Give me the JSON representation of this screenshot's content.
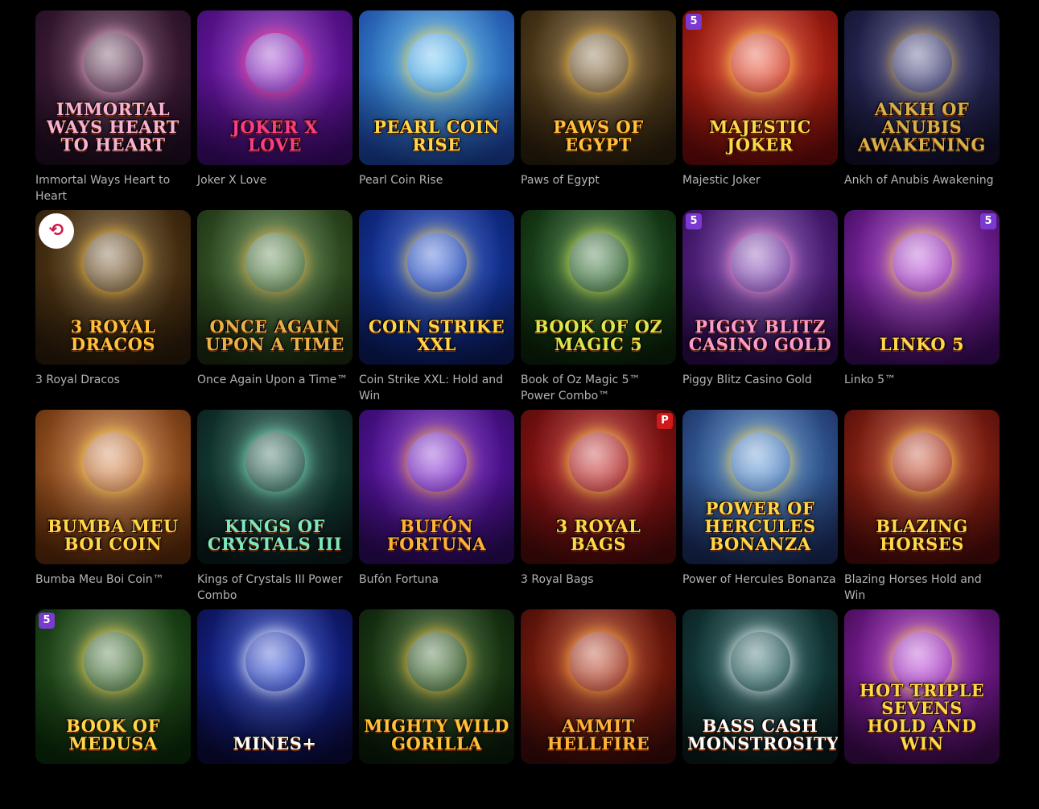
{
  "games": [
    {
      "name": "Immortal Ways Heart to Heart",
      "logo": "Immortal Ways Heart to Heart",
      "bg1": "#5a2a4a",
      "bg2": "#1e0c20",
      "accent": "#f7b2d6",
      "badge": null
    },
    {
      "name": "Joker X Love",
      "logo": "Joker X Love",
      "bg1": "#8a1fc4",
      "bg2": "#3a0a6a",
      "accent": "#ff3b8a",
      "badge": null
    },
    {
      "name": "Pearl Coin Rise",
      "logo": "Pearl Coin Rise",
      "bg1": "#4ab8f0",
      "bg2": "#1a3f9a",
      "accent": "#ffd84a",
      "badge": null
    },
    {
      "name": "Paws of Egypt",
      "logo": "Paws of Egypt",
      "bg1": "#7a5a2a",
      "bg2": "#2a1e0c",
      "accent": "#ffc23a",
      "badge": null
    },
    {
      "name": "Majestic Joker",
      "logo": "Majestic Joker",
      "bg1": "#e83a1a",
      "bg2": "#6a0a0a",
      "accent": "#ffd84a",
      "badge": "5"
    },
    {
      "name": "Ankh of Anubis Awakening",
      "logo": "Ankh of Anubis Awakening",
      "bg1": "#3a3a7a",
      "bg2": "#10102a",
      "accent": "#d7b24a",
      "badge": null
    },
    {
      "name": "3 Royal Dracos",
      "logo": "3 Royal Dracos",
      "bg1": "#6a4a1a",
      "bg2": "#2a1a0a",
      "accent": "#ffc23a",
      "badge": "round"
    },
    {
      "name": "Once Again Upon a Time™",
      "logo": "Once Again Upon a Time",
      "bg1": "#4a7a3a",
      "bg2": "#1a2a10",
      "accent": "#e6b24a",
      "badge": null
    },
    {
      "name": "Coin Strike XXL: Hold and Win",
      "logo": "Coin Strike XXL",
      "bg1": "#1a4ad0",
      "bg2": "#0a1a5a",
      "accent": "#ffd84a",
      "badge": null
    },
    {
      "name": "Book of Oz Magic 5™ Power Combo™",
      "logo": "Book of Oz Magic 5",
      "bg1": "#2a6a2a",
      "bg2": "#0a200a",
      "accent": "#d7e84a",
      "badge": null
    },
    {
      "name": "Piggy Blitz Casino Gold",
      "logo": "Piggy Blitz Casino Gold",
      "bg1": "#7a3ab0",
      "bg2": "#2a0a4a",
      "accent": "#ff9ad0",
      "badge": "5"
    },
    {
      "name": "Linko 5™",
      "logo": "Linko 5",
      "bg1": "#b03ad0",
      "bg2": "#3a0a5a",
      "accent": "#ffd84a",
      "badge": "5"
    },
    {
      "name": "Bumba Meu Boi Coin™",
      "logo": "Bumba Meu Boi Coin",
      "bg1": "#d07a3a",
      "bg2": "#5a2a0a",
      "accent": "#ffd84a",
      "badge": null
    },
    {
      "name": "Kings of Crystals III Power Combo",
      "logo": "Kings of Crystals III",
      "bg1": "#1a5a4a",
      "bg2": "#0a1a1a",
      "accent": "#7ae8c0",
      "badge": null
    },
    {
      "name": "Bufón Fortuna",
      "logo": "Bufón Fortuna",
      "bg1": "#7a1ad0",
      "bg2": "#2a0a5a",
      "accent": "#ffb23a",
      "badge": null
    },
    {
      "name": "3 Royal Bags",
      "logo": "3 Royal Bags",
      "bg1": "#c01a1a",
      "bg2": "#4a0a0a",
      "accent": "#ffd84a",
      "badge": "P"
    },
    {
      "name": "Power of Hercules Bonanza",
      "logo": "Power of Hercules Bonanza",
      "bg1": "#4a8ad0",
      "bg2": "#1a2a5a",
      "accent": "#ffd84a",
      "badge": null
    },
    {
      "name": "Blazing Horses Hold and Win",
      "logo": "Blazing Horses",
      "bg1": "#c03a1a",
      "bg2": "#4a0a0a",
      "accent": "#ffd84a",
      "badge": null
    },
    {
      "name": "",
      "logo": "Book of Medusa",
      "bg1": "#3a6a2a",
      "bg2": "#0a2a0a",
      "accent": "#ffd84a",
      "badge": "5"
    },
    {
      "name": "",
      "logo": "Mines+",
      "bg1": "#1a3ad0",
      "bg2": "#0a0a3a",
      "accent": "#ffffff",
      "badge": null
    },
    {
      "name": "",
      "logo": "Mighty Wild Gorilla",
      "bg1": "#2a5a1a",
      "bg2": "#0a1a0a",
      "accent": "#ffc23a",
      "badge": null
    },
    {
      "name": "",
      "logo": "Ammit Hellfire",
      "bg1": "#b02a0a",
      "bg2": "#3a0a0a",
      "accent": "#ffb23a",
      "badge": null
    },
    {
      "name": "",
      "logo": "Bass Cash Monstrosity",
      "bg1": "#1a5a5a",
      "bg2": "#0a1a1a",
      "accent": "#ffffff",
      "badge": null
    },
    {
      "name": "",
      "logo": "Hot Triple Sevens Hold and Win",
      "bg1": "#b02ad0",
      "bg2": "#3a0a4a",
      "accent": "#ffd84a",
      "badge": null
    }
  ]
}
